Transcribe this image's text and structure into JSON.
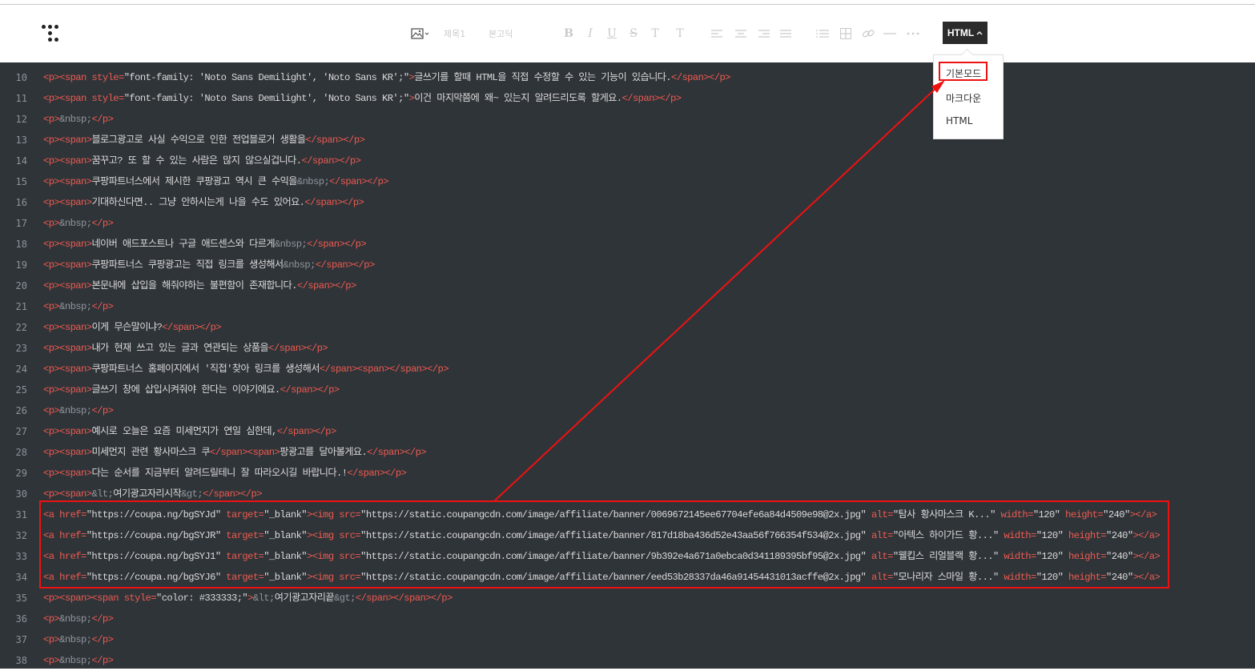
{
  "toolbar": {
    "icons": [
      "image-icon",
      "bold-icon",
      "italic-icon",
      "underline-icon",
      "strikethrough-icon",
      "text-color-icon",
      "text-background-icon",
      "align-left-icon",
      "align-center-icon",
      "align-right-icon",
      "align-justify-icon",
      "list-icon",
      "table-icon",
      "link-icon",
      "horizontal-rule-icon",
      "more-icon"
    ],
    "heading_label": "제목1",
    "font_label": "본고딕",
    "bold": "B",
    "italic": "I",
    "underline": "U",
    "strike": "S",
    "text_color": "T",
    "bg_color": "T",
    "mode_button": "HTML"
  },
  "dropdown": {
    "items": [
      "기본모드",
      "마크다운",
      "HTML"
    ]
  },
  "annotation": {
    "color": "#ee1111"
  },
  "lines": [
    {
      "n": "10",
      "parts": [
        [
          "tag",
          "<p><span style="
        ],
        [
          "str",
          "\"font-family: 'Noto Sans Demilight', 'Noto Sans KR';\""
        ],
        [
          "tag",
          ">"
        ],
        [
          "txt",
          "글쓰기를 할때 HTML을 직접 수정할 수 있는 기능이 있습니다."
        ],
        [
          "tag",
          "</span></p>"
        ]
      ]
    },
    {
      "n": "11",
      "parts": [
        [
          "tag",
          "<p><span style="
        ],
        [
          "str",
          "\"font-family: 'Noto Sans Demilight', 'Noto Sans KR';\""
        ],
        [
          "tag",
          ">"
        ],
        [
          "txt",
          "이건 마지막쯤에 왜~ 있는지 알려드리도록 할게요."
        ],
        [
          "tag",
          "</span></p>"
        ]
      ]
    },
    {
      "n": "12",
      "parts": [
        [
          "tag",
          "<p>"
        ],
        [
          "ent",
          "&nbsp;"
        ],
        [
          "tag",
          "</p>"
        ]
      ]
    },
    {
      "n": "13",
      "parts": [
        [
          "tag",
          "<p><span>"
        ],
        [
          "txt",
          "블로그광고로 사실 수익으로 인한 전업블로거 생활을"
        ],
        [
          "tag",
          "</span></p>"
        ]
      ]
    },
    {
      "n": "14",
      "parts": [
        [
          "tag",
          "<p><span>"
        ],
        [
          "txt",
          "꿈꾸고? 또 할 수 있는 사람은 많지 않으실겁니다."
        ],
        [
          "tag",
          "</span></p>"
        ]
      ]
    },
    {
      "n": "15",
      "parts": [
        [
          "tag",
          "<p><span>"
        ],
        [
          "txt",
          "쿠팡파트너스에서 제시한 쿠팡광고 역시 큰 수익을"
        ],
        [
          "ent",
          "&nbsp;"
        ],
        [
          "tag",
          "</span></p>"
        ]
      ]
    },
    {
      "n": "16",
      "parts": [
        [
          "tag",
          "<p><span>"
        ],
        [
          "txt",
          "기대하신다면.. 그냥 안하시는게 나을 수도 있어요."
        ],
        [
          "tag",
          "</span></p>"
        ]
      ]
    },
    {
      "n": "17",
      "parts": [
        [
          "tag",
          "<p>"
        ],
        [
          "ent",
          "&nbsp;"
        ],
        [
          "tag",
          "</p>"
        ]
      ]
    },
    {
      "n": "18",
      "parts": [
        [
          "tag",
          "<p><span>"
        ],
        [
          "txt",
          "네이버 애드포스트나 구글 애드센스와 다르게"
        ],
        [
          "ent",
          "&nbsp;"
        ],
        [
          "tag",
          "</span></p>"
        ]
      ]
    },
    {
      "n": "19",
      "parts": [
        [
          "tag",
          "<p><span>"
        ],
        [
          "txt",
          "쿠팡파트너스 쿠팡광고는 직접 링크를 생성해서"
        ],
        [
          "ent",
          "&nbsp;"
        ],
        [
          "tag",
          "</span></p>"
        ]
      ]
    },
    {
      "n": "20",
      "parts": [
        [
          "tag",
          "<p><span>"
        ],
        [
          "txt",
          "본문내에 삽입을 해줘야하는 불편함이 존재합니다."
        ],
        [
          "tag",
          "</span></p>"
        ]
      ]
    },
    {
      "n": "21",
      "parts": [
        [
          "tag",
          "<p>"
        ],
        [
          "ent",
          "&nbsp;"
        ],
        [
          "tag",
          "</p>"
        ]
      ]
    },
    {
      "n": "22",
      "parts": [
        [
          "tag",
          "<p><span>"
        ],
        [
          "txt",
          "이게 무슨말이냐?"
        ],
        [
          "tag",
          "</span></p>"
        ]
      ]
    },
    {
      "n": "23",
      "parts": [
        [
          "tag",
          "<p><span>"
        ],
        [
          "txt",
          "내가 현재 쓰고 있는 글과 연관되는 상품을"
        ],
        [
          "tag",
          "</span></p>"
        ]
      ]
    },
    {
      "n": "24",
      "parts": [
        [
          "tag",
          "<p><span>"
        ],
        [
          "txt",
          "쿠팡파트너스 홈페이지에서 '직접'찾아 링크를 생성해서"
        ],
        [
          "tag",
          "</span><span></span></p>"
        ]
      ]
    },
    {
      "n": "25",
      "parts": [
        [
          "tag",
          "<p><span>"
        ],
        [
          "txt",
          "글쓰기 창에 삽입시켜줘야 한다는 이야기에요."
        ],
        [
          "tag",
          "</span></p>"
        ]
      ]
    },
    {
      "n": "26",
      "parts": [
        [
          "tag",
          "<p>"
        ],
        [
          "ent",
          "&nbsp;"
        ],
        [
          "tag",
          "</p>"
        ]
      ]
    },
    {
      "n": "27",
      "parts": [
        [
          "tag",
          "<p><span>"
        ],
        [
          "txt",
          "예시로 오늘은 요즘 미세먼지가 연일 심한데,"
        ],
        [
          "tag",
          "</span></p>"
        ]
      ]
    },
    {
      "n": "28",
      "parts": [
        [
          "tag",
          "<p><span>"
        ],
        [
          "txt",
          "미세먼지 관련 황사마스크 쿠"
        ],
        [
          "tag",
          "</span><span>"
        ],
        [
          "txt",
          "팡광고를 달아볼게요."
        ],
        [
          "tag",
          "</span></p>"
        ]
      ]
    },
    {
      "n": "29",
      "parts": [
        [
          "tag",
          "<p><span>"
        ],
        [
          "txt",
          "다는 순서를 지금부터 알려드릴테니 잘 따라오시길 바랍니다.!"
        ],
        [
          "tag",
          "</span></p>"
        ]
      ]
    },
    {
      "n": "30",
      "parts": [
        [
          "tag",
          "<p><span>"
        ],
        [
          "ent",
          "&lt;"
        ],
        [
          "txt",
          "여기광고자리시작"
        ],
        [
          "ent",
          "&gt;"
        ],
        [
          "tag",
          "</span></p>"
        ]
      ]
    },
    {
      "n": "31",
      "parts": [
        [
          "tag",
          "<a href="
        ],
        [
          "str",
          "\"https://coupa.ng/bgSYJd\""
        ],
        [
          "tag",
          " target="
        ],
        [
          "str",
          "\"_blank\""
        ],
        [
          "tag",
          "><img src="
        ],
        [
          "str",
          "\"https://static.coupangcdn.com/image/affiliate/banner/0069672145ee67704efe6a84d4509e98@2x.jpg\""
        ],
        [
          "tag",
          " alt="
        ],
        [
          "str",
          "\"탐사 황사마스크 K...\""
        ],
        [
          "tag",
          " width="
        ],
        [
          "str",
          "\"120\""
        ],
        [
          "tag",
          " height="
        ],
        [
          "str",
          "\"240\""
        ],
        [
          "tag",
          "></a>"
        ]
      ]
    },
    {
      "n": "32",
      "parts": [
        [
          "tag",
          "<a href="
        ],
        [
          "str",
          "\"https://coupa.ng/bgSYJR\""
        ],
        [
          "tag",
          " target="
        ],
        [
          "str",
          "\"_blank\""
        ],
        [
          "tag",
          "><img src="
        ],
        [
          "str",
          "\"https://static.coupangcdn.com/image/affiliate/banner/817d18ba436d52e43aa56f766354f534@2x.jpg\""
        ],
        [
          "tag",
          " alt="
        ],
        [
          "str",
          "\"아텍스 하이가드 황...\""
        ],
        [
          "tag",
          " width="
        ],
        [
          "str",
          "\"120\""
        ],
        [
          "tag",
          " height="
        ],
        [
          "str",
          "\"240\""
        ],
        [
          "tag",
          "></a>"
        ]
      ]
    },
    {
      "n": "33",
      "parts": [
        [
          "tag",
          "<a href="
        ],
        [
          "str",
          "\"https://coupa.ng/bgSYJ1\""
        ],
        [
          "tag",
          " target="
        ],
        [
          "str",
          "\"_blank\""
        ],
        [
          "tag",
          "><img src="
        ],
        [
          "str",
          "\"https://static.coupangcdn.com/image/affiliate/banner/9b392e4a671a0ebca0d341189395bf95@2x.jpg\""
        ],
        [
          "tag",
          " alt="
        ],
        [
          "str",
          "\"웰킵스 리얼블랙 황...\""
        ],
        [
          "tag",
          " width="
        ],
        [
          "str",
          "\"120\""
        ],
        [
          "tag",
          " height="
        ],
        [
          "str",
          "\"240\""
        ],
        [
          "tag",
          "></a>"
        ]
      ]
    },
    {
      "n": "34",
      "parts": [
        [
          "tag",
          "<a href="
        ],
        [
          "str",
          "\"https://coupa.ng/bgSYJ6\""
        ],
        [
          "tag",
          " target="
        ],
        [
          "str",
          "\"_blank\""
        ],
        [
          "tag",
          "><img src="
        ],
        [
          "str",
          "\"https://static.coupangcdn.com/image/affiliate/banner/eed53b28337da46a91454431013acffe@2x.jpg\""
        ],
        [
          "tag",
          " alt="
        ],
        [
          "str",
          "\"모나리자 스마일 황...\""
        ],
        [
          "tag",
          " width="
        ],
        [
          "str",
          "\"120\""
        ],
        [
          "tag",
          " height="
        ],
        [
          "str",
          "\"240\""
        ],
        [
          "tag",
          "></a>"
        ]
      ]
    },
    {
      "n": "35",
      "parts": [
        [
          "tag",
          "<p><span><span style="
        ],
        [
          "str",
          "\"color: #333333;\""
        ],
        [
          "tag",
          ">"
        ],
        [
          "ent",
          "&lt;"
        ],
        [
          "txt",
          "여기광고자리끝"
        ],
        [
          "ent",
          "&gt;"
        ],
        [
          "tag",
          "</span></span></p>"
        ]
      ]
    },
    {
      "n": "36",
      "parts": [
        [
          "tag",
          "<p>"
        ],
        [
          "ent",
          "&nbsp;"
        ],
        [
          "tag",
          "</p>"
        ]
      ]
    },
    {
      "n": "37",
      "parts": [
        [
          "tag",
          "<p>"
        ],
        [
          "ent",
          "&nbsp;"
        ],
        [
          "tag",
          "</p>"
        ]
      ]
    },
    {
      "n": "38",
      "parts": [
        [
          "tag",
          "<p>"
        ],
        [
          "ent",
          "&nbsp;"
        ],
        [
          "tag",
          "</p>"
        ]
      ]
    }
  ]
}
